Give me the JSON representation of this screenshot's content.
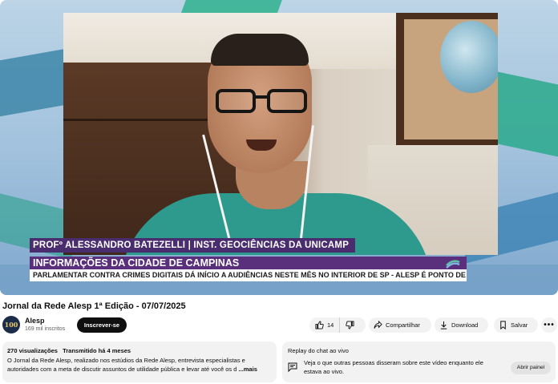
{
  "player": {
    "lower_third": {
      "name": "PROFº ALESSANDRO BATEZELLI | INST. GEOCIÊNCIAS DA UNICAMP",
      "title": "INFORMAÇÕES DA CIDADE DE CAMPINAS",
      "ticker": "PARLAMENTAR CONTRA CRIMES DIGITAIS DÁ INÍCIO A AUDIÊNCIAS NESTE MÊS NO INTERIOR DE SP - ALESP É PONTO DE A"
    },
    "colors": {
      "lower_third_bg": "#5a2f7c",
      "shirt": "#2d9a8d"
    }
  },
  "video": {
    "title": "Jornal da Rede Alesp 1ª Edição - 07/07/2025"
  },
  "channel": {
    "avatar_text": "100",
    "name": "Alesp",
    "subscribers": "169 mil inscritos",
    "subscribe_label": "Inscrever-se"
  },
  "actions": {
    "like_count": "14",
    "share_label": "Compartilhar",
    "download_label": "Download",
    "save_label": "Salvar",
    "more_label": "•••"
  },
  "description": {
    "views": "270 visualizações",
    "streamed": "Transmitido há 4 meses",
    "text": "O Jornal da Rede Alesp, realizado nos estúdios da Rede Alesp, entrevista especialistas e autoridades com a meta de discutir assuntos de utilidade pública e levar até você os d",
    "more": "...mais"
  },
  "chat_replay": {
    "title": "Replay do chat ao vivo",
    "text": "Veja o que outras pessoas disseram sobre este vídeo enquanto ele estava ao vivo.",
    "button": "Abrir painel"
  }
}
